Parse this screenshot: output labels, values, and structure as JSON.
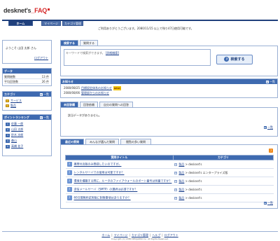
{
  "header": {
    "logo_main": "desknet's",
    "logo_faq": "FAQ",
    "tabs": [
      {
        "label": "ホーム"
      },
      {
        "label": "マイページ"
      },
      {
        "label": "カテゴリ管理"
      }
    ],
    "notice": "ご利用ありがとうございます。2080/11/15 以上で残り47日使用可能です。"
  },
  "sidebar": {
    "welcome": "ようこそ 山田 太郎 さん",
    "logout": "ログアウト",
    "data_title": "データ",
    "data_rows": [
      {
        "label": "質問総数",
        "value": "13 件"
      },
      {
        "label": "平均回答数",
        "value": "26 件"
      }
    ],
    "category_title": "カテゴリ",
    "category_more": "一覧",
    "categories": [
      {
        "label": "サービス"
      },
      {
        "label": "製品"
      }
    ],
    "ranking_title": "ポイントランキング",
    "ranking_more": "一覧",
    "ranking": [
      {
        "rank": "1",
        "name": "佐藤 一郎"
      },
      {
        "rank": "2",
        "name": "山田 太郎"
      },
      {
        "rank": "3",
        "name": "鈴木 次郎"
      },
      {
        "rank": "4",
        "name": "森山"
      },
      {
        "rank": "5",
        "name": "高橋 花子"
      }
    ]
  },
  "search": {
    "tabs": [
      {
        "label": "検索する"
      },
      {
        "label": "質問する"
      }
    ],
    "placeholder": "キーワードで検索ができます。",
    "detail_link": "[詳細検索]",
    "button_label": "検索する"
  },
  "news": {
    "title": "お知らせ",
    "more": "一覧",
    "items": [
      {
        "date": "2080/08/25",
        "text": "目標設定体系のお知らせ",
        "badge": "NEW!"
      },
      {
        "date": "2080/08/06",
        "text": "管理部からのお知らせ",
        "badge": ""
      }
    ]
  },
  "answers": {
    "tabs": [
      {
        "label": "未回答欄"
      },
      {
        "label": "回答依頼"
      },
      {
        "label": "自分の質問への回答"
      }
    ],
    "empty_text": "該当データがありません。",
    "more": "一覧"
  },
  "popular": {
    "tabs": [
      {
        "label": "最近の質問"
      },
      {
        "label": "みんなが選んだ質問"
      },
      {
        "label": "閲覧の多い質問"
      }
    ],
    "col_title": "質問タイトル",
    "col_category": "カテゴリ",
    "rows": [
      {
        "title": "携帯付近版のみ登録したいのですが。",
        "cat_parent": "製品",
        "cat_child": "desknet's"
      },
      {
        "title": "レンタルサーバでの使用は可能ですか？",
        "cat_parent": "製品",
        "cat_child": "desknet's エンタープライズ版"
      },
      {
        "title": "環境を構築する際に、ルータのファイアウォールのポート番号は何番ですか？",
        "cat_parent": "製品",
        "cat_child": "desknet's"
      },
      {
        "title": "送信メールサーバ（SMTP）の選択は必須ですか？",
        "cat_parent": "製品",
        "cat_child": "desknet's"
      },
      {
        "title": "60日間無料試用版に制限事項はありますか？",
        "cat_parent": "製品",
        "cat_child": "desknet's"
      }
    ],
    "more": "一覧"
  },
  "footer": {
    "links": [
      {
        "label": "ホーム"
      },
      {
        "label": "マイページ"
      },
      {
        "label": "カテゴリ管理"
      },
      {
        "label": "ヘルプ"
      },
      {
        "label": "ログアウト"
      }
    ],
    "copyright": "Copyright (C) 2080 NEOJAPAN Inc. All Rights Reserved."
  }
}
